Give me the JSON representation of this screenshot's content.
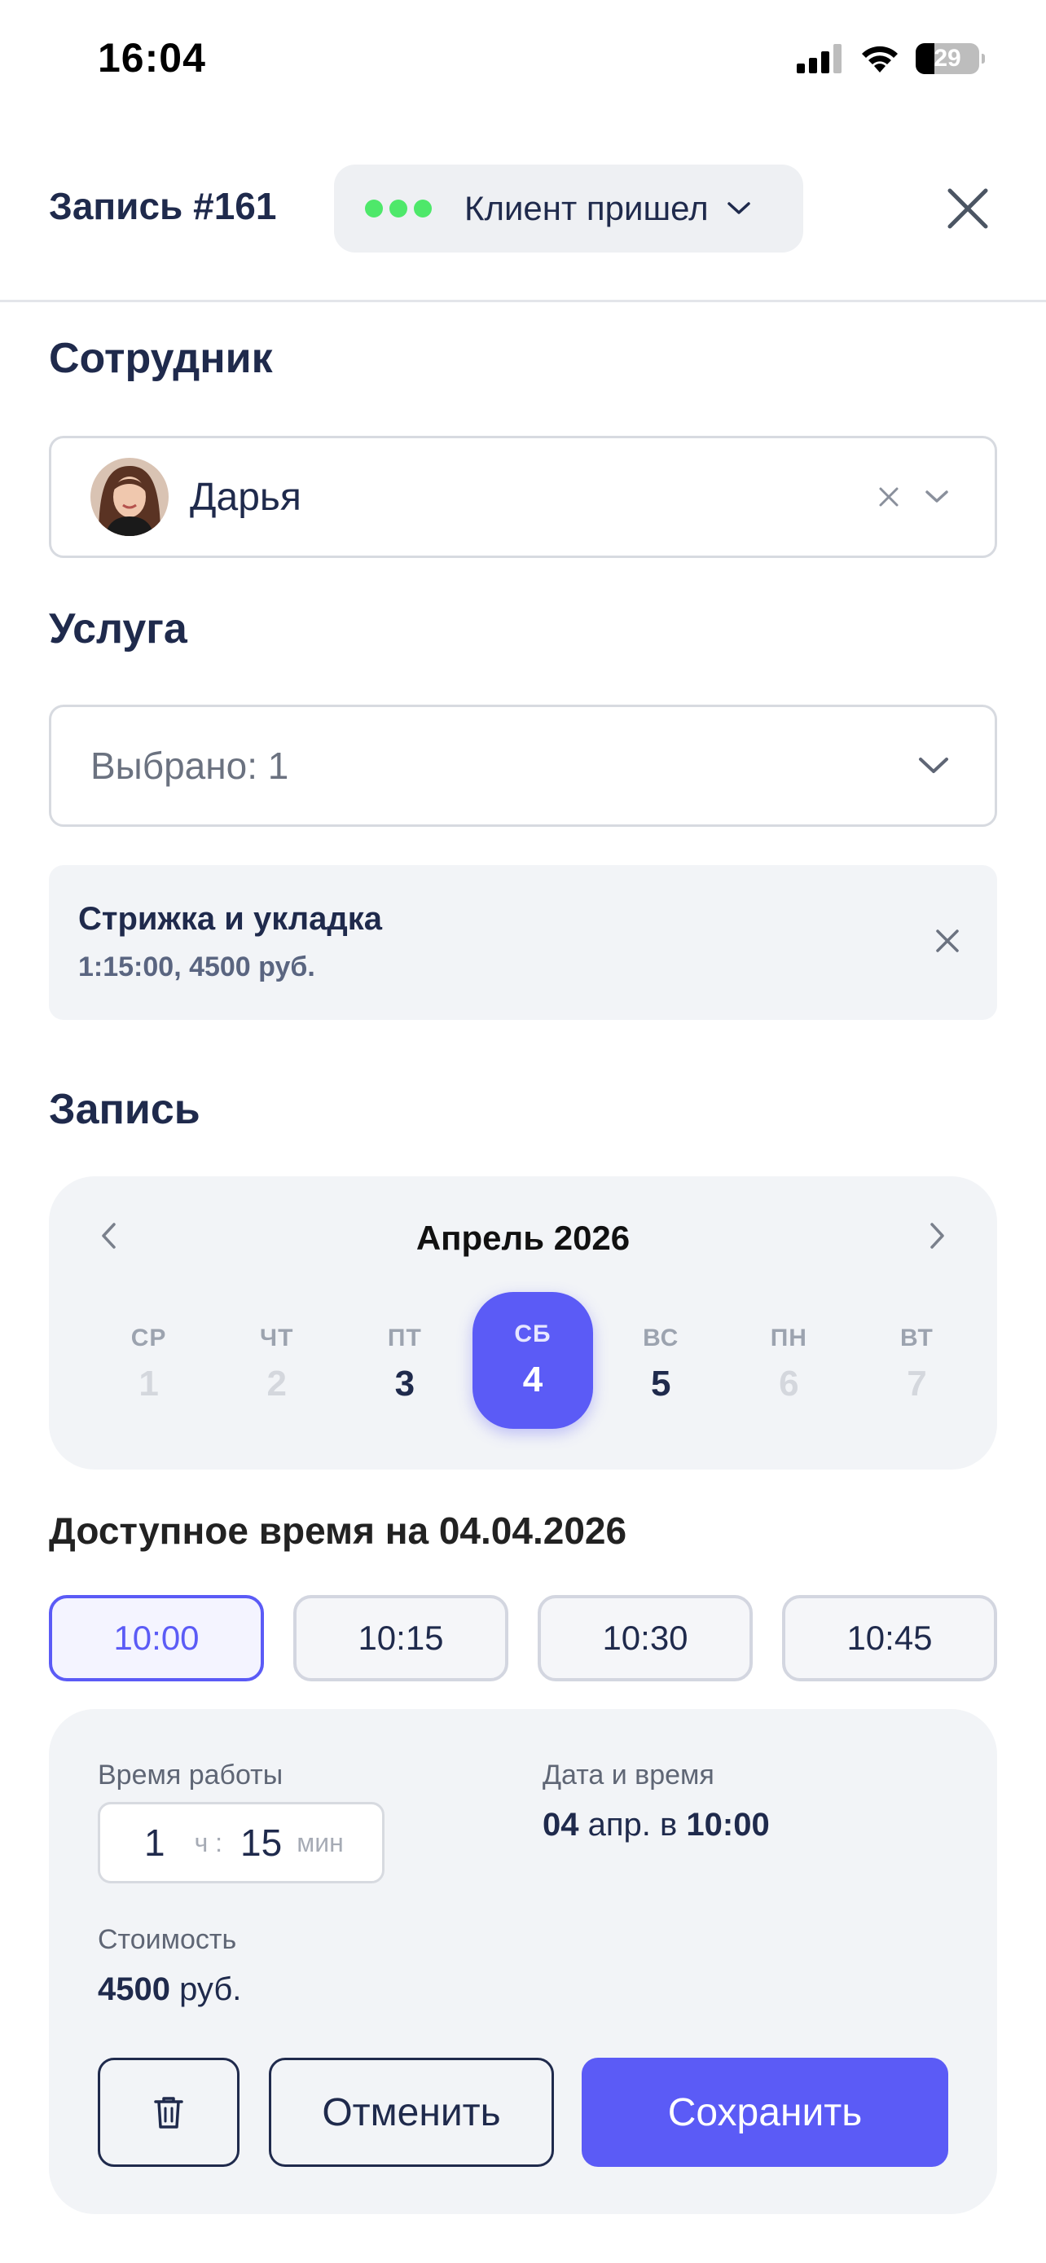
{
  "status_bar": {
    "time": "16:04",
    "battery": "29"
  },
  "header": {
    "title": "Запись #161",
    "status": "Клиент пришел",
    "status_color": "#4ee86a"
  },
  "employee": {
    "section_title": "Сотрудник",
    "name": "Дарья"
  },
  "service": {
    "section_title": "Услуга",
    "placeholder": "Выбрано: 1",
    "items": [
      {
        "name": "Стрижка и укладка",
        "meta": "1:15:00, 4500 руб."
      }
    ]
  },
  "booking": {
    "section_title": "Запись",
    "month": "Апрель 2026",
    "days": [
      {
        "dow": "СР",
        "num": "1",
        "state": "disabled"
      },
      {
        "dow": "ЧТ",
        "num": "2",
        "state": "disabled"
      },
      {
        "dow": "ПТ",
        "num": "3",
        "state": "enabled"
      },
      {
        "dow": "СБ",
        "num": "4",
        "state": "selected"
      },
      {
        "dow": "ВС",
        "num": "5",
        "state": "enabled"
      },
      {
        "dow": "ПН",
        "num": "6",
        "state": "disabled"
      },
      {
        "dow": "ВТ",
        "num": "7",
        "state": "disabled"
      }
    ],
    "available_title": "Доступное время на 04.04.2026",
    "slots": [
      "10:00",
      "10:15",
      "10:30",
      "10:45"
    ],
    "selected_slot": "10:00"
  },
  "summary": {
    "duration_label": "Время работы",
    "hours": "1",
    "hours_unit": "ч",
    "minutes": "15",
    "minutes_unit": "мин",
    "datetime_label": "Дата и время",
    "date_bold": "04",
    "date_mid": "апр. в",
    "time_bold": "10:00",
    "price_label": "Стоимость",
    "price_bold": "4500",
    "price_unit": "руб."
  },
  "actions": {
    "cancel": "Отменить",
    "save": "Сохранить"
  },
  "colors": {
    "accent": "#5b5bf6",
    "text": "#1f2a4c",
    "surface": "#f2f4f7"
  }
}
